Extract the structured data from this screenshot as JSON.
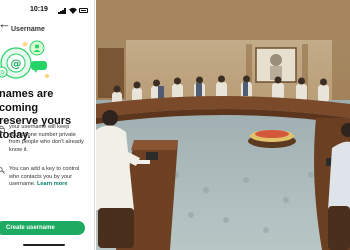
{
  "phone_screen": {
    "status_bar": {
      "time": "10:19"
    },
    "screen_title": "Username",
    "headline_lines": [
      "names are coming",
      "reserve yours today."
    ],
    "body_item_1_lines": [
      "your username will keep",
      "your phone number private",
      "from people who don't already",
      "know it."
    ],
    "body_item_2_lines": [
      "You can add a key to control",
      "who contacts you by your",
      "username."
    ],
    "learn_more_link": "Learn more",
    "create_button_label": "Create username",
    "colors": {
      "accent_green": "#1daa61",
      "link_green": "#008069"
    }
  },
  "photo": {
    "description_icon": "meeting-room-photo"
  }
}
